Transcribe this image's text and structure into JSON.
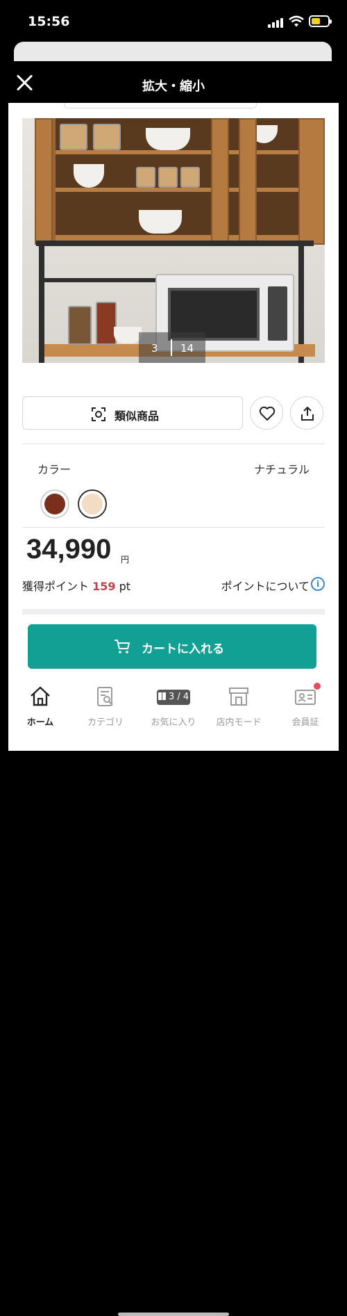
{
  "status": {
    "time": "15:56"
  },
  "modal": {
    "title": "拡大・縮小"
  },
  "image": {
    "current": "3",
    "total": "14"
  },
  "actions": {
    "similar_label": "類似商品"
  },
  "color": {
    "label": "カラー",
    "selected": "ナチュラル",
    "swatches": [
      "#7a2e1c",
      "#f3dcc4"
    ]
  },
  "price": {
    "amount": "34,990",
    "unit": "円"
  },
  "points": {
    "prefix": "獲得ポイント",
    "value": "159",
    "unit": "pt",
    "about": "ポイントについて",
    "info_icon": "i"
  },
  "cart": {
    "label": "カートに入れる"
  },
  "tabs": [
    {
      "label": "ホーム"
    },
    {
      "label": "カテゴリ"
    },
    {
      "label": "お気に入り",
      "badge": "3 / 4"
    },
    {
      "label": "店内モード"
    },
    {
      "label": "会員証"
    }
  ],
  "colors": {
    "accent": "#13a094",
    "points": "#c0414e"
  }
}
